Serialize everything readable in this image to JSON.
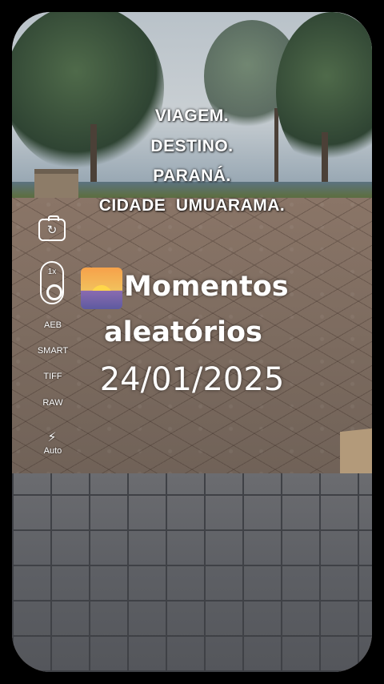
{
  "captions": {
    "line1": "VIAGEM.",
    "line2": "DESTINO.",
    "line3": "PARANÁ.",
    "line4": "CIDADE  UMUARAMA."
  },
  "camera_toolbar": {
    "switch_icon": "camera-switch-icon",
    "zoom_label": "1x",
    "modes": [
      "AEB",
      "SMART",
      "TIFF",
      "RAW"
    ],
    "flash_icon": "flash-icon",
    "flash_label": "Auto"
  },
  "title": {
    "emoji": "sunrise-emoji",
    "line1": "Momentos",
    "line2": "aleatórios",
    "date": "24/01/2025"
  }
}
